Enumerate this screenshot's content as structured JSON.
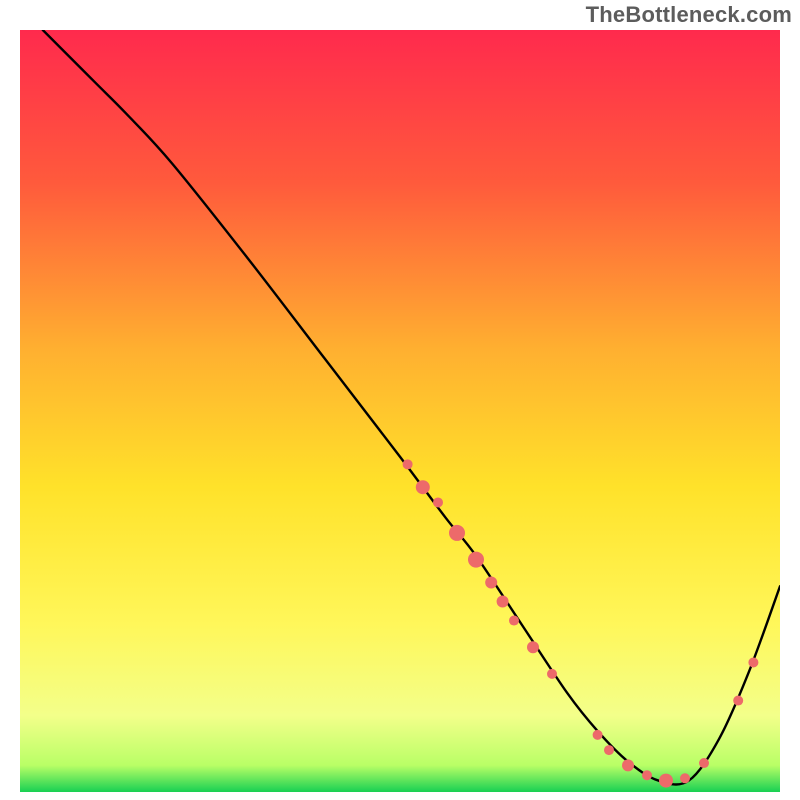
{
  "watermark": "TheBottleneck.com",
  "chart_data": {
    "type": "line",
    "title": "",
    "xlabel": "",
    "ylabel": "",
    "xlim": [
      0,
      100
    ],
    "ylim": [
      0,
      100
    ],
    "grid": false,
    "legend": false,
    "background_gradient_stops": [
      {
        "offset": 0.0,
        "color": "#ff2a4d"
      },
      {
        "offset": 0.2,
        "color": "#ff5a3c"
      },
      {
        "offset": 0.42,
        "color": "#ffb030"
      },
      {
        "offset": 0.6,
        "color": "#ffe22a"
      },
      {
        "offset": 0.78,
        "color": "#fff75a"
      },
      {
        "offset": 0.9,
        "color": "#f3ff8a"
      },
      {
        "offset": 0.965,
        "color": "#b9ff66"
      },
      {
        "offset": 1.0,
        "color": "#18d053"
      }
    ],
    "series": [
      {
        "name": "bottleneck-curve",
        "color": "#000000",
        "x": [
          3,
          6,
          10,
          14,
          20,
          30,
          40,
          50,
          56,
          60,
          66,
          72,
          76,
          80,
          84,
          88,
          92,
          96,
          100
        ],
        "y": [
          100,
          97,
          93,
          89,
          82.5,
          70,
          57,
          44,
          36,
          31,
          22,
          13,
          8,
          4,
          1.5,
          1.5,
          7,
          16,
          27
        ]
      }
    ],
    "markers": {
      "color": "#ed6a6a",
      "points": [
        {
          "x": 51,
          "y": 43,
          "r": 5
        },
        {
          "x": 53,
          "y": 40,
          "r": 7
        },
        {
          "x": 55,
          "y": 38,
          "r": 5
        },
        {
          "x": 57.5,
          "y": 34,
          "r": 8
        },
        {
          "x": 60,
          "y": 30.5,
          "r": 8
        },
        {
          "x": 62,
          "y": 27.5,
          "r": 6
        },
        {
          "x": 63.5,
          "y": 25,
          "r": 6
        },
        {
          "x": 65,
          "y": 22.5,
          "r": 5
        },
        {
          "x": 67.5,
          "y": 19,
          "r": 6
        },
        {
          "x": 70,
          "y": 15.5,
          "r": 5
        },
        {
          "x": 76,
          "y": 7.5,
          "r": 5
        },
        {
          "x": 77.5,
          "y": 5.5,
          "r": 5
        },
        {
          "x": 80,
          "y": 3.5,
          "r": 6
        },
        {
          "x": 82.5,
          "y": 2.2,
          "r": 5
        },
        {
          "x": 85,
          "y": 1.5,
          "r": 7
        },
        {
          "x": 87.5,
          "y": 1.8,
          "r": 5
        },
        {
          "x": 90,
          "y": 3.8,
          "r": 5
        },
        {
          "x": 94.5,
          "y": 12,
          "r": 5
        },
        {
          "x": 96.5,
          "y": 17,
          "r": 5
        }
      ]
    }
  }
}
